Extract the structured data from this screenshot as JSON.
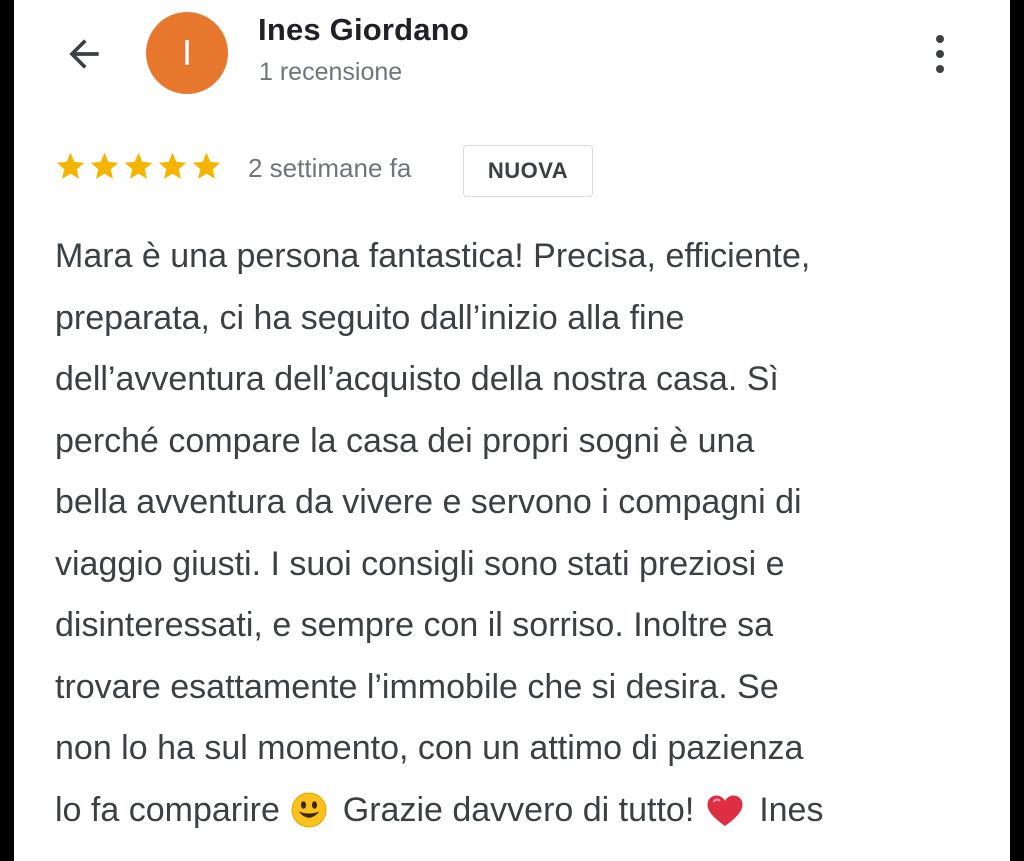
{
  "header": {
    "back_icon": "arrow-left-icon",
    "avatar_letter": "I",
    "avatar_color": "#e8772e",
    "reviewer_name": "Ines Giordano",
    "review_count": "1 recensione",
    "more_icon": "more-vert-icon"
  },
  "review": {
    "rating": 5,
    "rating_max": 5,
    "star_color": "#f4b400",
    "date": "2 settimane fa",
    "badge": "NUOVA",
    "lines": [
      "Mara è una persona fantastica! Precisa, efficiente,",
      "preparata, ci ha seguito dall’inizio alla fine",
      "dell’avventura dell’acquisto della nostra casa. Sì",
      "perché compare la casa dei propri sogni è una",
      "bella avventura da vivere e servono i compagni di",
      "viaggio giusti. I suoi consigli sono stati preziosi e",
      "disinteressati, e sempre con il sorriso. Inoltre sa",
      "trovare esattamente l’immobile che si desira. Se",
      "non lo ha sul momento, con un attimo di pazienza"
    ],
    "last_line": {
      "part1": "lo fa comparire",
      "emoji1": "smiley-emoji-icon",
      "part2": "Grazie davvero di tutto!",
      "emoji2": "red-heart-emoji-icon",
      "part3": "Ines"
    }
  }
}
